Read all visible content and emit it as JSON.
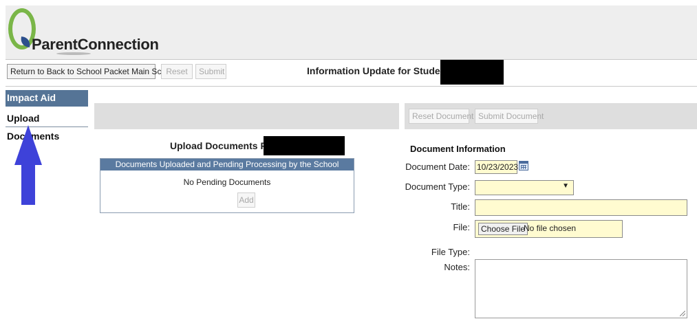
{
  "header": {
    "logo_text": "ParentConnection"
  },
  "toolbar": {
    "return_label": "Return to Back to School Packet Main Screen",
    "reset_label": "Reset",
    "submit_label": "Submit",
    "info_title": "Information Update for Student"
  },
  "sidebar": {
    "items": [
      {
        "label": "Impact Aid"
      },
      {
        "label": "Upload Documents"
      }
    ]
  },
  "upload": {
    "title": "Upload Documents For",
    "table_header": "Documents Uploaded and Pending Processing by the School",
    "empty_text": "No Pending Documents",
    "add_label": "Add"
  },
  "doc_actions": {
    "reset_label": "Reset Document",
    "submit_label": "Submit Document"
  },
  "document": {
    "section_title": "Document Information",
    "date_label": "Document Date:",
    "date_value": "10/23/2023",
    "type_label": "Document Type:",
    "type_value": "",
    "title_label": "Title:",
    "title_value": "",
    "file_label": "File:",
    "choose_file_label": "Choose File",
    "file_status": "No file chosen",
    "filetype_label": "File Type:",
    "notes_label": "Notes:"
  },
  "colors": {
    "header_bg": "#eeeeee",
    "sidebar_active": "#557496",
    "table_header": "#5a7aa0",
    "field_highlight": "#fffbd0",
    "annotation_arrow": "#3e42d9",
    "logo_green": "#7ab648",
    "logo_blue": "#2c4f8c"
  }
}
